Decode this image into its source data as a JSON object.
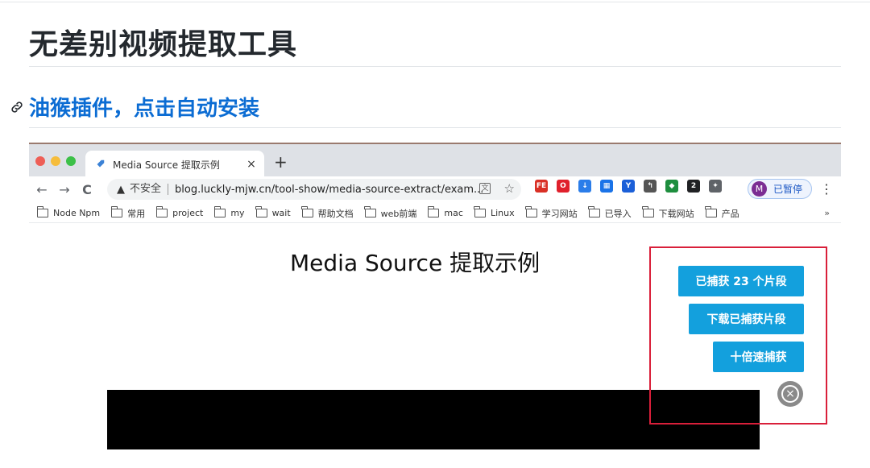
{
  "article": {
    "title": "无差别视频提取工具",
    "section_link": "油猴插件，点击自动安装"
  },
  "browser": {
    "tab_title": "Media Source 提取示例",
    "new_tab_label": "+",
    "tab_close_label": "×",
    "nav": {
      "back_label": "←",
      "forward_label": "→",
      "reload_label": "C"
    },
    "omnibox": {
      "security_label": "不安全",
      "url": "blog.luckly-mjw.cn/tool-show/media-source-extract/exam..."
    },
    "profile": {
      "initial": "M",
      "status": "已暂停"
    },
    "extensions": [
      {
        "name": "fe-extension-icon",
        "label": "FE",
        "color": "#d93025"
      },
      {
        "name": "opera-extension-icon",
        "label": "O",
        "color": "#e0202c"
      },
      {
        "name": "download-extension-icon",
        "label": "↓",
        "color": "#2b7de9"
      },
      {
        "name": "qr-extension-icon",
        "label": "▦",
        "color": "#1a73e8"
      },
      {
        "name": "vue-extension-icon",
        "label": "Y",
        "color": "#1b5fd8"
      },
      {
        "name": "reply-extension-icon",
        "label": "↰",
        "color": "#555555"
      },
      {
        "name": "tag-extension-icon",
        "label": "◆",
        "color": "#1e8e3e"
      },
      {
        "name": "badge-extension-icon",
        "label": "2",
        "color": "#202124"
      },
      {
        "name": "puzzle-extension-icon",
        "label": "✦",
        "color": "#5f6368"
      }
    ],
    "bookmarks": [
      "Node Npm",
      "常用",
      "project",
      "my",
      "wait",
      "帮助文档",
      "web前端",
      "mac",
      "Linux",
      "学习网站",
      "已导入",
      "下载网站",
      "产品"
    ],
    "bookmarks_more": "»"
  },
  "demo_page": {
    "heading": "Media Source 提取示例",
    "buttons": {
      "captured": "已捕获 23 个片段",
      "download": "下载已捕获片段",
      "speed": "十倍速捕获"
    },
    "close_label": "×"
  },
  "colors": {
    "link": "#0b6cd3",
    "button": "#13a0dd",
    "highlight": "#d91f3a"
  }
}
